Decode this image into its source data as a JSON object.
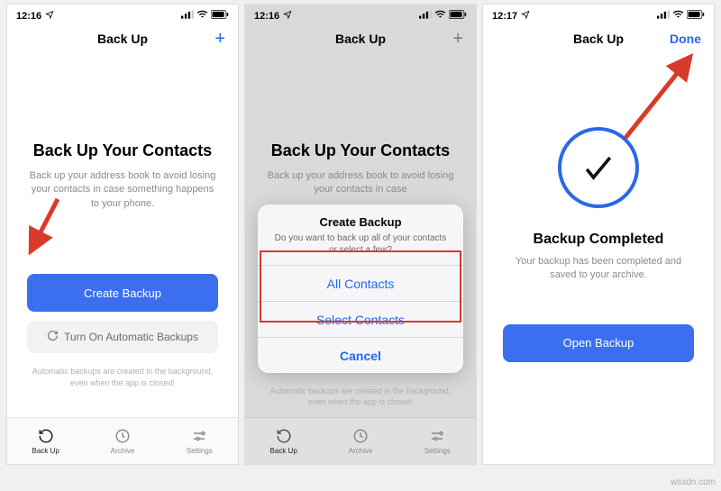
{
  "frame1": {
    "status_time": "12:16",
    "nav_title": "Back Up",
    "heading": "Back Up Your Contacts",
    "sub": "Back up your address book to avoid losing your contacts in case something happens to your phone.",
    "primary": "Create Backup",
    "secondary": "Turn On Automatic Backups",
    "tiny": "Automatic backups are created in the background, even when the app is closed!"
  },
  "frame2": {
    "status_time": "12:16",
    "nav_title": "Back Up",
    "heading": "Back Up Your Contacts",
    "sub": "Back up your address book to avoid losing your contacts in case",
    "sheet": {
      "title": "Create Backup",
      "sub": "Do you want to back up all of your contacts or select a few?",
      "opt1": "All Contacts",
      "opt2": "Select Contacts",
      "cancel": "Cancel"
    },
    "tiny": "Automatic backups are created in the background, even when the app is closed!"
  },
  "frame3": {
    "status_time": "12:17",
    "nav_title": "Back Up",
    "done": "Done",
    "heading": "Backup Completed",
    "sub": "Your backup has been completed and saved to your archive.",
    "open": "Open Backup"
  },
  "tabs": {
    "backup": "Back Up",
    "archive": "Archive",
    "settings": "Settings"
  },
  "watermark": "wsxdn.com"
}
